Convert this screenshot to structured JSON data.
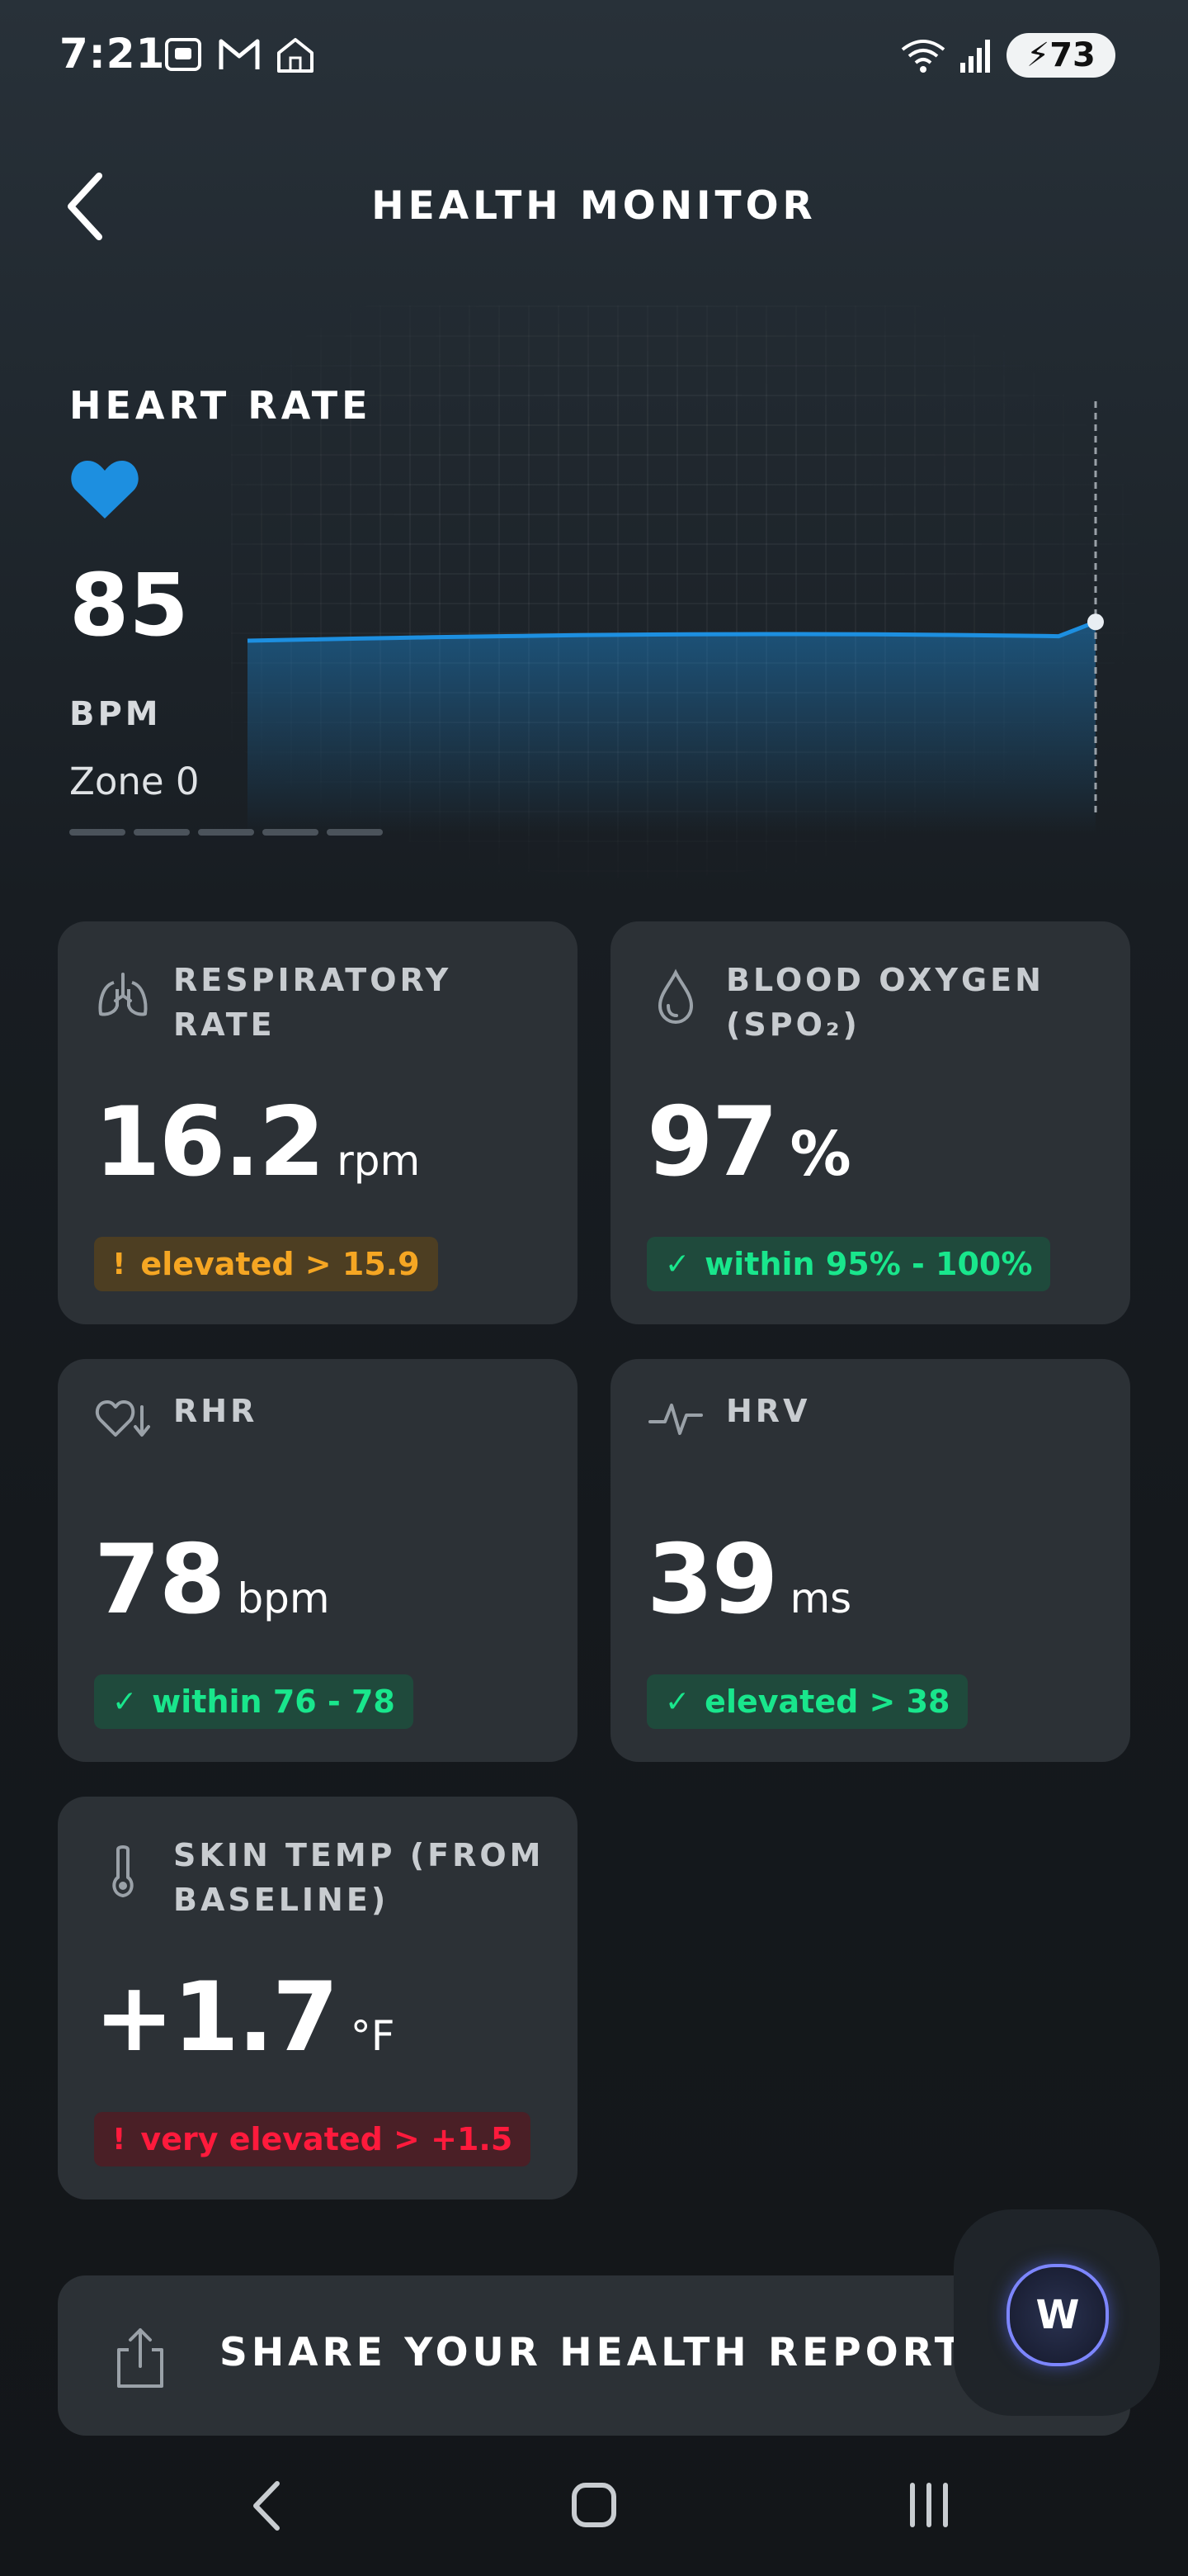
{
  "status_bar": {
    "time": "7:21",
    "battery": "73",
    "left_icons": [
      "screenshot-icon",
      "gmail-icon",
      "home-icon"
    ],
    "right_icons": [
      "wifi-icon",
      "signal-icon",
      "battery-charging-icon"
    ]
  },
  "header": {
    "title": "HEALTH MONITOR"
  },
  "heart_rate": {
    "title": "HEART RATE",
    "value": "85",
    "unit": "BPM",
    "zone": "Zone 0",
    "accent": "#1d8fe0",
    "trend": [
      86,
      86,
      86,
      86,
      86,
      86,
      86,
      86,
      86,
      86,
      86,
      86,
      86,
      86,
      86,
      86,
      86,
      86,
      86,
      86,
      86,
      86,
      86,
      85
    ]
  },
  "metrics": [
    {
      "label": "RESPIRATORY RATE",
      "value": "16.2",
      "unit": "rpm",
      "status": "elevated > 15.9",
      "status_mark": "!",
      "status_type": "warn",
      "icon": "lungs-icon"
    },
    {
      "label": "BLOOD OXYGEN (SPO₂)",
      "value": "97",
      "unit": "%",
      "status": "within 95% - 100%",
      "status_mark": "✓",
      "status_type": "ok",
      "icon": "droplet-icon"
    },
    {
      "label": "RHR",
      "value": "78",
      "unit": "bpm",
      "status": "within 76 - 78",
      "status_mark": "✓",
      "status_type": "ok",
      "icon": "heart-down-icon"
    },
    {
      "label": "HRV",
      "value": "39",
      "unit": "ms",
      "status": "elevated > 38",
      "status_mark": "✓",
      "status_type": "ok",
      "icon": "pulse-icon"
    },
    {
      "label": "SKIN TEMP (FROM BASELINE)",
      "value": "+1.7",
      "unit": "°F",
      "status": "very elevated > +1.5",
      "status_mark": "!",
      "status_type": "bad",
      "icon": "thermometer-icon"
    }
  ],
  "share": {
    "label": "SHARE YOUR HEALTH REPORT"
  },
  "fab": {
    "label": "W"
  },
  "colors": {
    "warn": "#f5a623",
    "ok": "#19e68c",
    "bad": "#ff1a3c",
    "card": "#2c3136"
  }
}
